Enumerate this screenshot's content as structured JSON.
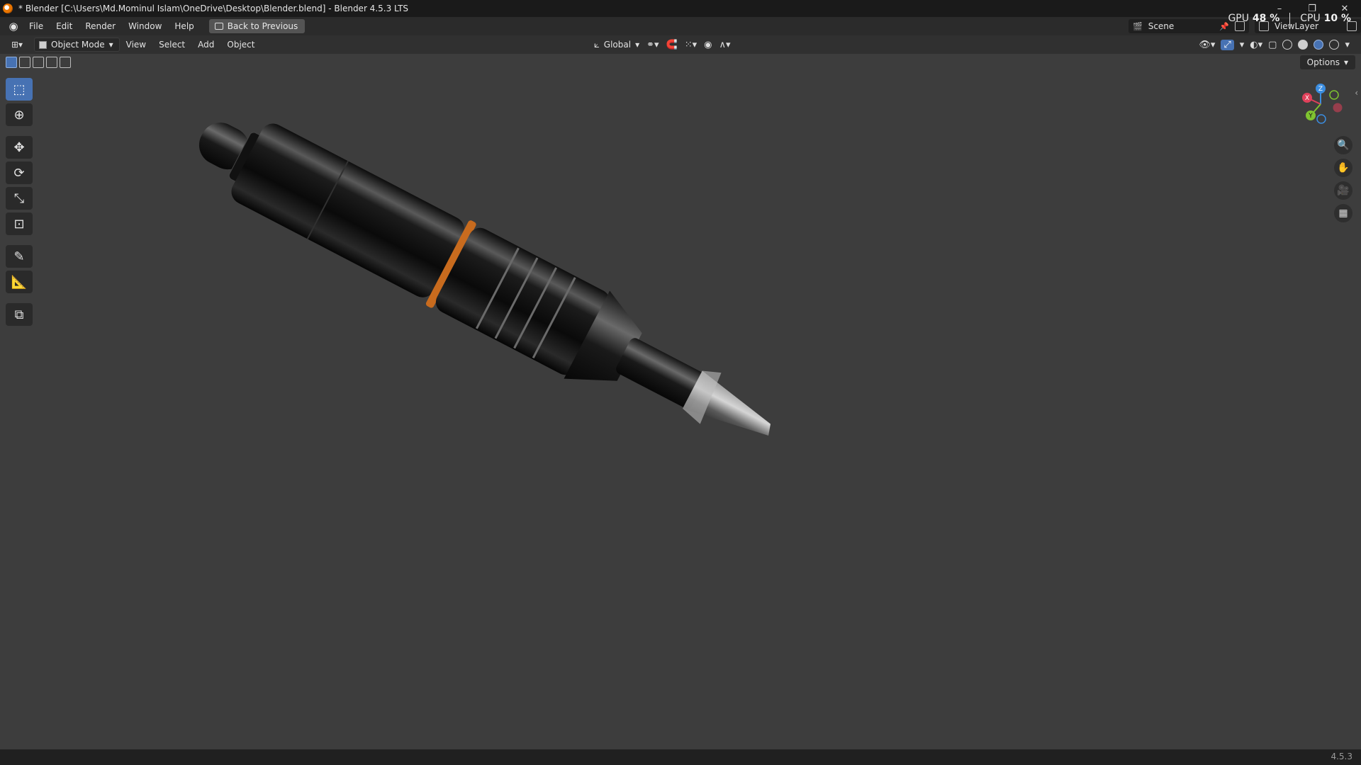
{
  "window": {
    "title": "* Blender [C:\\Users\\Md.Mominul Islam\\OneDrive\\Desktop\\Blender.blend] - Blender 4.5.3 LTS",
    "minimize_glyph": "–",
    "restore_glyph": "❐",
    "close_glyph": "✕"
  },
  "menu": {
    "items": [
      "File",
      "Edit",
      "Render",
      "Window",
      "Help"
    ],
    "back_button": "Back to Previous"
  },
  "scene": {
    "name": "Scene",
    "view_layer": "ViewLayer"
  },
  "stats": {
    "gpu_label": "GPU",
    "gpu_value": "48 %",
    "cpu_label": "CPU",
    "cpu_value": "10 %"
  },
  "viewport_header": {
    "mode": "Object Mode",
    "menus": [
      "View",
      "Select",
      "Add",
      "Object"
    ],
    "transform_orientation": "Global",
    "options_label": "Options"
  },
  "gizmo": {
    "x_label": "X",
    "y_label": "Y",
    "z_label": "Z",
    "colors": {
      "x": "#e0405a",
      "y": "#7fc430",
      "z": "#3b8de0"
    }
  },
  "status": {
    "version": "4.5.3"
  },
  "colors": {
    "accent": "#4772b3",
    "viewport_bg": "#3d3d3d"
  }
}
